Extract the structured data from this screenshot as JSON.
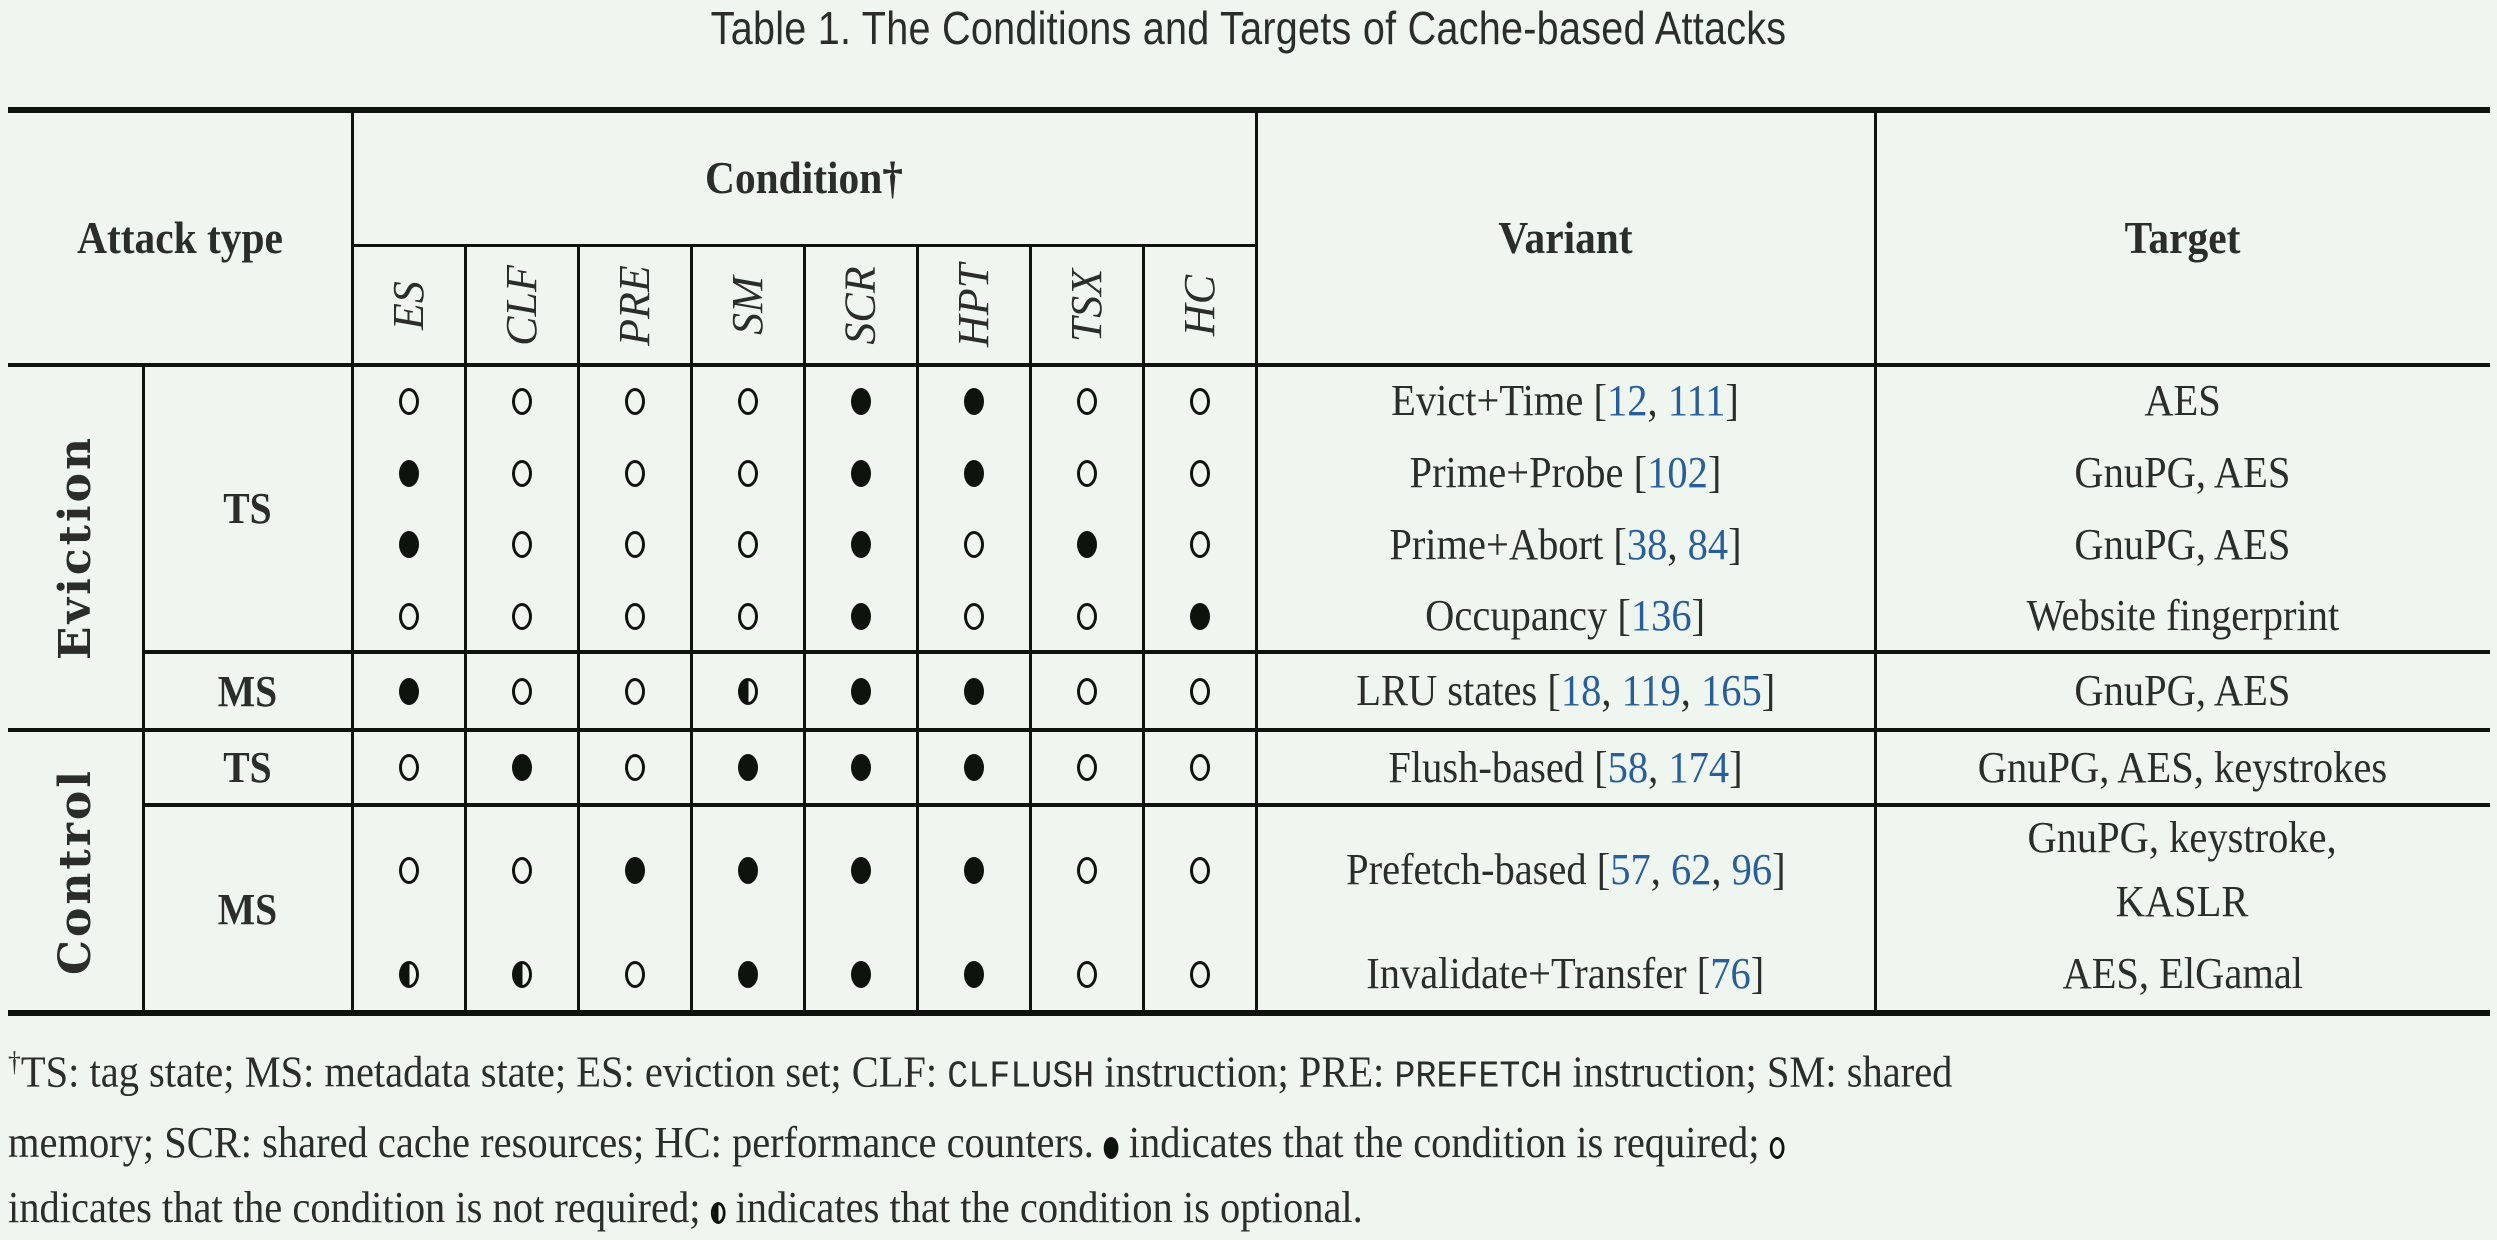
{
  "caption": "Table 1.  The Conditions and Targets of Cache-based Attacks",
  "headers": {
    "attack_type": "Attack type",
    "condition": "Condition†",
    "variant": "Variant",
    "target": "Target",
    "conditions": [
      "ES",
      "CLF",
      "PRE",
      "SM",
      "SCR",
      "HPT",
      "TSX",
      "HC"
    ]
  },
  "groups": [
    {
      "label": "Eviction"
    },
    {
      "label": "Control"
    }
  ],
  "kinds": [
    {
      "label": "TS"
    },
    {
      "label": "MS"
    },
    {
      "label": "TS"
    },
    {
      "label": "MS"
    }
  ],
  "rows": [
    {
      "group": "Eviction",
      "kind": "TS",
      "marks": [
        "no",
        "no",
        "no",
        "no",
        "req",
        "req",
        "no",
        "no"
      ],
      "variant": "Evict+Time",
      "cites": [
        "12",
        "111"
      ],
      "target": "AES"
    },
    {
      "group": "Eviction",
      "kind": "TS",
      "marks": [
        "req",
        "no",
        "no",
        "no",
        "req",
        "req",
        "no",
        "no"
      ],
      "variant": "Prime+Probe",
      "cites": [
        "102"
      ],
      "target": "GnuPG, AES"
    },
    {
      "group": "Eviction",
      "kind": "TS",
      "marks": [
        "req",
        "no",
        "no",
        "no",
        "req",
        "no",
        "req",
        "no"
      ],
      "variant": "Prime+Abort",
      "cites": [
        "38",
        "84"
      ],
      "target": "GnuPG, AES"
    },
    {
      "group": "Eviction",
      "kind": "TS",
      "marks": [
        "no",
        "no",
        "no",
        "no",
        "req",
        "no",
        "no",
        "req"
      ],
      "variant": "Occupancy",
      "cites": [
        "136"
      ],
      "target": "Website fingerprint"
    },
    {
      "group": "Eviction",
      "kind": "MS",
      "marks": [
        "req",
        "no",
        "no",
        "opt",
        "req",
        "req",
        "no",
        "no"
      ],
      "variant": "LRU states",
      "cites": [
        "18",
        "119",
        "165"
      ],
      "target": "GnuPG, AES"
    },
    {
      "group": "Control",
      "kind": "TS",
      "marks": [
        "no",
        "req",
        "no",
        "req",
        "req",
        "req",
        "no",
        "no"
      ],
      "variant": "Flush-based",
      "cites": [
        "58",
        "174"
      ],
      "target": "GnuPG, AES, keystrokes"
    },
    {
      "group": "Control",
      "kind": "MS",
      "marks": [
        "no",
        "no",
        "req",
        "req",
        "req",
        "req",
        "no",
        "no"
      ],
      "variant": "Prefetch-based",
      "cites": [
        "57",
        "62",
        "96"
      ],
      "target": "GnuPG, keystroke, KASLR",
      "target_lines": [
        "GnuPG, keystroke,",
        "KASLR"
      ]
    },
    {
      "group": "Control",
      "kind": "MS",
      "marks": [
        "opt",
        "opt",
        "no",
        "req",
        "req",
        "req",
        "no",
        "no"
      ],
      "variant": "Invalidate+Transfer",
      "cites": [
        "76"
      ],
      "target": "AES, ElGamal"
    }
  ],
  "legend": {
    "req": "indicates that the condition is required",
    "no": "indicates that the condition is not required",
    "opt": "indicates that the condition is optional"
  },
  "footnote": {
    "dagger": "†",
    "line1_a": "TS: tag state; MS: metadata state; ES: eviction set; CLF: ",
    "line1_code1": "CLFLUSH",
    "line1_b": " instruction; PRE: ",
    "line1_code2": "PREFETCH",
    "line1_c": " instruction; SM: shared",
    "line2_a": "memory; SCR: shared cache resources; HC: performance counters. ",
    "line2_b": " indicates that the condition is required; ",
    "line3_a": "indicates that the condition is not required; ",
    "line3_b": " indicates that the condition is optional."
  }
}
